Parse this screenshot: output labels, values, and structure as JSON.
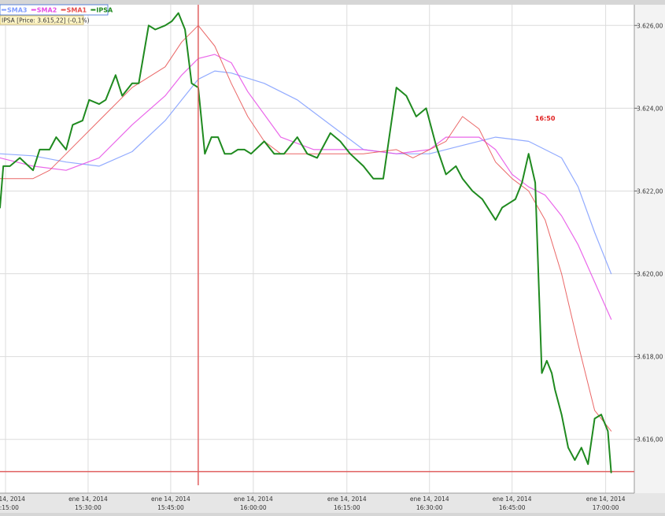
{
  "chart_data": {
    "type": "line",
    "legend": [
      {
        "name": "SMA3",
        "color": "#7f9cff"
      },
      {
        "name": "SMA2",
        "color": "#e64ce6"
      },
      {
        "name": "SMA1",
        "color": "#e64c4c"
      },
      {
        "name": "IPSA",
        "color": "#1f8a1f"
      }
    ],
    "price_box": "IPSA [Price: 3.615,22] (-0,1%)",
    "cursor_time_label": "16:50",
    "cursor_time_label_value": 16.85,
    "crosshair_x_value": 15.8,
    "baseline_y_value": 3615.22,
    "ylim": [
      3614.7,
      3626.5
    ],
    "xlim": [
      15.2,
      17.12
    ],
    "legend_position": "top-left",
    "y_ticks": [
      {
        "value": 3626,
        "label": "3.626,00"
      },
      {
        "value": 3624,
        "label": "3.624,00"
      },
      {
        "value": 3622,
        "label": "3.622,00"
      },
      {
        "value": 3620,
        "label": "3.620,00"
      },
      {
        "value": 3618,
        "label": "3.618,00"
      },
      {
        "value": 3616,
        "label": "3.616,00"
      }
    ],
    "x_ticks": [
      {
        "value": 15.2167,
        "date": "ene 14, 2014",
        "time": "15:15:00"
      },
      {
        "value": 15.4667,
        "date": "ene 14, 2014",
        "time": "15:30:00"
      },
      {
        "value": 15.7167,
        "date": "ene 14, 2014",
        "time": "15:45:00"
      },
      {
        "value": 15.9667,
        "date": "ene 14, 2014",
        "time": "16:00:00"
      },
      {
        "value": 16.25,
        "date": "ene 14, 2014",
        "time": "16:15:00"
      },
      {
        "value": 16.5,
        "date": "ene 14, 2014",
        "time": "16:30:00"
      },
      {
        "value": 16.75,
        "date": "ene 14, 2014",
        "time": "16:45:00"
      },
      {
        "value": 17.0333,
        "date": "ene 14, 2014",
        "time": "17:00:00"
      }
    ],
    "series": [
      {
        "name": "SMA3",
        "color": "#7f9cff",
        "width": 1.2,
        "x": [
          15.2,
          15.3,
          15.4,
          15.5,
          15.6,
          15.7,
          15.75,
          15.8,
          15.85,
          15.9,
          16.0,
          16.1,
          16.2,
          16.3,
          16.4,
          16.5,
          16.6,
          16.7,
          16.8,
          16.85,
          16.9,
          16.95,
          17.0,
          17.05
        ],
        "y": [
          3622.9,
          3622.85,
          3622.7,
          3622.6,
          3622.95,
          3623.7,
          3624.2,
          3624.7,
          3624.9,
          3624.85,
          3624.6,
          3624.2,
          3623.6,
          3623.0,
          3622.9,
          3622.9,
          3623.1,
          3623.3,
          3623.2,
          3623.0,
          3622.8,
          3622.1,
          3621.0,
          3620.0
        ]
      },
      {
        "name": "SMA2",
        "color": "#e64ce6",
        "width": 1.2,
        "x": [
          15.2,
          15.3,
          15.4,
          15.5,
          15.6,
          15.7,
          15.75,
          15.8,
          15.85,
          15.9,
          15.95,
          16.05,
          16.15,
          16.3,
          16.4,
          16.5,
          16.55,
          16.6,
          16.65,
          16.7,
          16.75,
          16.8,
          16.85,
          16.9,
          16.95,
          17.0,
          17.05
        ],
        "y": [
          3622.8,
          3622.6,
          3622.5,
          3622.8,
          3623.6,
          3624.3,
          3624.8,
          3625.2,
          3625.3,
          3625.1,
          3624.4,
          3623.3,
          3623.0,
          3623.0,
          3622.9,
          3623.0,
          3623.3,
          3623.3,
          3623.3,
          3623.0,
          3622.4,
          3622.1,
          3621.9,
          3621.4,
          3620.7,
          3619.8,
          3618.9
        ]
      },
      {
        "name": "SMA1",
        "color": "#e64c4c",
        "width": 1.0,
        "x": [
          15.2,
          15.3,
          15.35,
          15.4,
          15.5,
          15.6,
          15.7,
          15.75,
          15.8,
          15.85,
          15.9,
          15.95,
          16.0,
          16.05,
          16.1,
          16.2,
          16.3,
          16.4,
          16.45,
          16.5,
          16.55,
          16.6,
          16.65,
          16.7,
          16.75,
          16.8,
          16.85,
          16.9,
          16.95,
          17.0,
          17.05
        ],
        "y": [
          3622.3,
          3622.3,
          3622.5,
          3622.9,
          3623.7,
          3624.5,
          3625.0,
          3625.6,
          3626.0,
          3625.5,
          3624.6,
          3623.8,
          3623.2,
          3622.9,
          3622.9,
          3622.9,
          3622.9,
          3623.0,
          3622.8,
          3623.0,
          3623.2,
          3623.8,
          3623.5,
          3622.7,
          3622.3,
          3622.0,
          3621.3,
          3620.0,
          3618.3,
          3616.7,
          3616.2
        ]
      },
      {
        "name": "IPSA",
        "color": "#1f8a1f",
        "width": 2.0,
        "x": [
          15.2,
          15.21,
          15.23,
          15.26,
          15.3,
          15.32,
          15.35,
          15.37,
          15.4,
          15.42,
          15.45,
          15.47,
          15.5,
          15.52,
          15.55,
          15.57,
          15.6,
          15.62,
          15.65,
          15.67,
          15.7,
          15.72,
          15.74,
          15.76,
          15.78,
          15.8,
          15.82,
          15.84,
          15.86,
          15.88,
          15.9,
          15.92,
          15.94,
          15.96,
          16.0,
          16.03,
          16.06,
          16.1,
          16.13,
          16.16,
          16.2,
          16.23,
          16.26,
          16.3,
          16.33,
          16.36,
          16.4,
          16.43,
          16.46,
          16.49,
          16.52,
          16.55,
          16.58,
          16.6,
          16.63,
          16.66,
          16.7,
          16.72,
          16.74,
          16.76,
          16.78,
          16.8,
          16.82,
          16.84,
          16.855,
          16.87,
          16.88,
          16.9,
          16.92,
          16.94,
          16.96,
          16.98,
          17.0,
          17.02,
          17.04,
          17.05
        ],
        "y": [
          3621.6,
          3622.6,
          3622.6,
          3622.8,
          3622.5,
          3623.0,
          3623.0,
          3623.3,
          3623.0,
          3623.6,
          3623.7,
          3624.2,
          3624.1,
          3624.2,
          3624.8,
          3624.3,
          3624.6,
          3624.6,
          3626.0,
          3625.9,
          3626.0,
          3626.1,
          3626.3,
          3625.9,
          3624.6,
          3624.5,
          3622.9,
          3623.3,
          3623.3,
          3622.9,
          3622.9,
          3623.0,
          3623.0,
          3622.9,
          3623.2,
          3622.9,
          3622.9,
          3623.3,
          3622.9,
          3622.8,
          3623.4,
          3623.2,
          3622.9,
          3622.6,
          3622.3,
          3622.3,
          3624.5,
          3624.3,
          3623.8,
          3624.0,
          3623.1,
          3622.4,
          3622.6,
          3622.3,
          3622.0,
          3621.8,
          3621.3,
          3621.6,
          3621.7,
          3621.8,
          3622.2,
          3622.9,
          3622.2,
          3617.6,
          3617.9,
          3617.6,
          3617.2,
          3616.6,
          3615.8,
          3615.5,
          3615.8,
          3615.4,
          3616.5,
          3616.6,
          3616.2,
          3615.2
        ]
      }
    ]
  }
}
